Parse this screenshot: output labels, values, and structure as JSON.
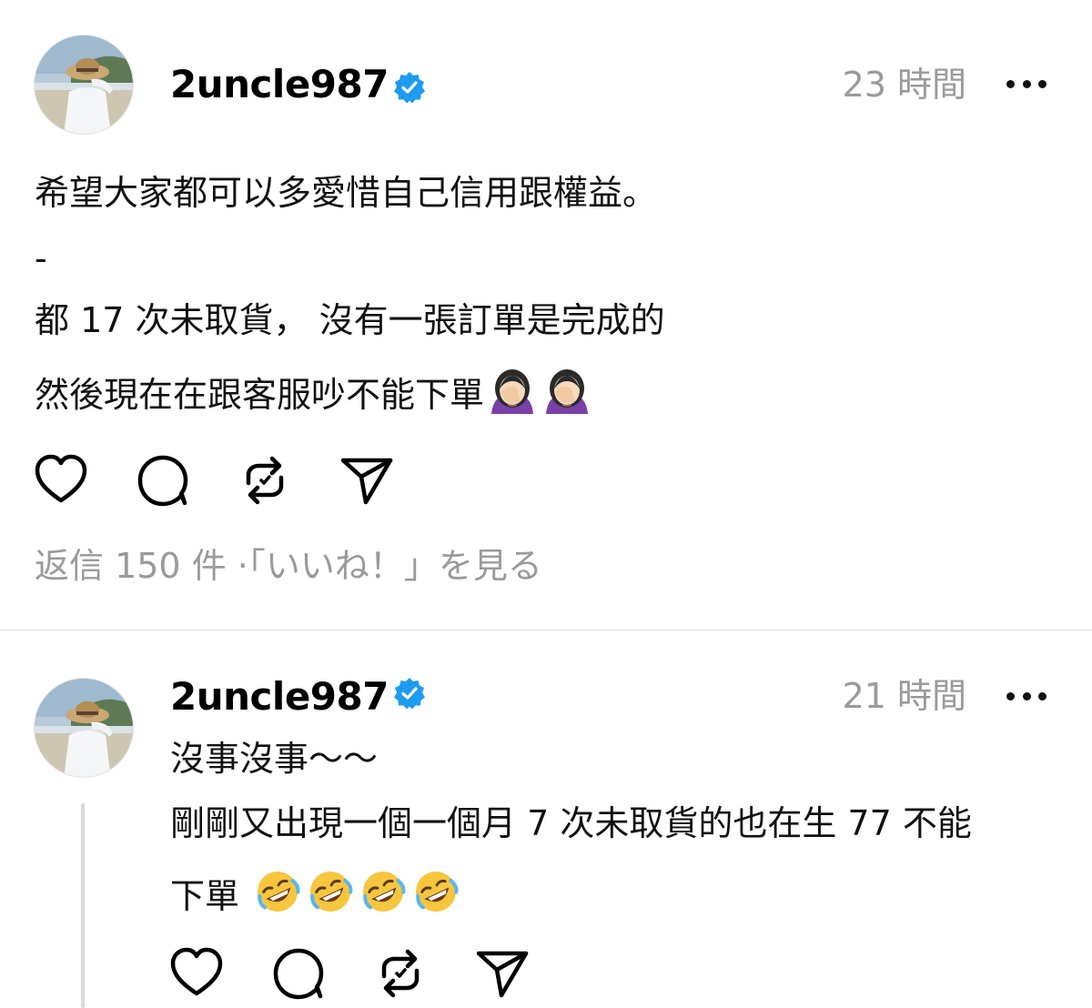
{
  "posts": [
    {
      "username": "2uncle987",
      "time": "23 時間",
      "lines": [
        "希望大家都可以多愛惜自己信用跟權益。",
        "-",
        "都 17 次未取貨， 沒有一張訂單是完成的",
        "然後現在在跟客服吵不能下單"
      ],
      "trailing_emoji": [
        "facepalm-woman-emoji",
        "facepalm-woman-emoji"
      ],
      "replies_link": "返信 150 件 ·「いいね！」を見る"
    },
    {
      "username": "2uncle987",
      "time": "21 時間",
      "lines": [
        "沒事沒事～～",
        "剛剛又出現一個一個月 7 次未取貨的也在生 77 不能",
        "下單"
      ],
      "trailing_emoji": [
        "rofl-emoji",
        "rofl-emoji",
        "rofl-emoji",
        "rofl-emoji"
      ]
    }
  ],
  "icons": {
    "like": "heart-icon",
    "comment": "comment-bubble-icon",
    "repost": "repost-icon",
    "share": "send-icon",
    "verified": "verified-badge-icon",
    "more": "more-dots-icon"
  },
  "colors": {
    "verified": "#1d9bf0",
    "muted": "#9a9a9a",
    "divider": "#dedede"
  }
}
